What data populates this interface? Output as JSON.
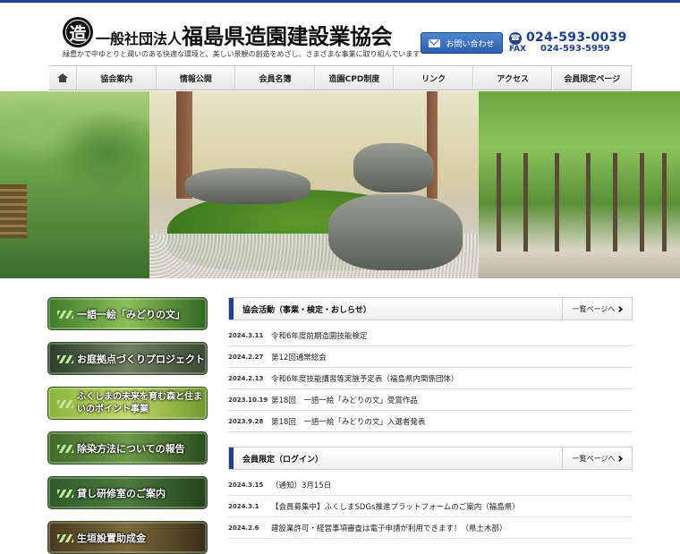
{
  "header": {
    "logo_char": "造",
    "org_prefix": "一般社団法人",
    "org_name": "福島県造園建設業協会",
    "tagline": "緑豊かで中ゆとりと潤いのある快適な環境と、美しい景観の創造をめざし、さまざまな事業に取り組んでいます",
    "contact_label": "お問い合わせ",
    "tel": "024-593-0039",
    "fax_label": "FAX",
    "fax": "024-593-5959",
    "icons": [
      "mail-icon",
      "phone-icon"
    ]
  },
  "nav": {
    "home_icon": "home-icon",
    "items": [
      "協会案内",
      "情報公開",
      "会員名簿",
      "造園CPD制度",
      "リンク",
      "アクセス",
      "会員限定ページ"
    ]
  },
  "sidebar": {
    "items": [
      {
        "label": "一語一絵「みどりの文」"
      },
      {
        "label": "お庭拠点づくりプロジェクト"
      },
      {
        "label": "ふくしまの未来を育む森と住まいのポイント事業"
      },
      {
        "label": "除染方法についての報告"
      },
      {
        "label": "貸し研修室のご案内"
      },
      {
        "label": "生垣設置助成金"
      }
    ]
  },
  "news": {
    "title": "協会活動（事業・検定・おしらせ）",
    "more_label": "一覧ページへ",
    "items": [
      {
        "date": "2024.3.11",
        "title": "令和6年度前期造園技能検定"
      },
      {
        "date": "2024.2.27",
        "title": "第12回通常総会"
      },
      {
        "date": "2024.2.13",
        "title": "令和6年度技能講習等実施予定表（福島県内関係団体）"
      },
      {
        "date": "2023.10.19",
        "title": "第18回　一語一絵「みどりの文」受賞作品"
      },
      {
        "date": "2023.9.28",
        "title": "第18回　一語一絵「みどりの文」入選者発表"
      }
    ]
  },
  "members": {
    "title": "会員限定（ログイン）",
    "more_label": "一覧ページへ",
    "items": [
      {
        "date": "2024.3.15",
        "title": "（通知）3月15日"
      },
      {
        "date": "2024.3.1",
        "title": "【会員募集中】ふくしまSDGs推進プラットフォームのご案内（福島県）"
      },
      {
        "date": "2024.2.6",
        "title": "建設業許可・経営事項審査は電子申請が利用できます！（県土木部）"
      }
    ]
  },
  "colors": {
    "accent": "#1f3f8f",
    "contact_button": "#2a5fb0"
  }
}
